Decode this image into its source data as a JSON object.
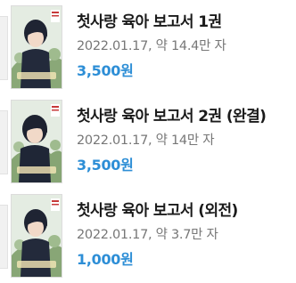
{
  "books": [
    {
      "title": "첫사랑 육아 보고서 1권",
      "date": "2022.01.17",
      "separator": ",",
      "count_label": "약 14.4만 자",
      "price": "3,500원",
      "cover_colors": {
        "bg": "#dce6dc",
        "hair": "#1d2230",
        "shirt": "#1f2636",
        "accent": "#c73a3a",
        "foliage": "#7a9a6a"
      }
    },
    {
      "title": "첫사랑 육아 보고서 2권 (완결)",
      "date": "2022.01.17",
      "separator": ",",
      "count_label": "약 14만 자",
      "price": "3,500원",
      "cover_colors": {
        "bg": "#dce6dc",
        "hair": "#1d2230",
        "shirt": "#1f2636",
        "accent": "#c73a3a",
        "foliage": "#7a9a6a"
      }
    },
    {
      "title": "첫사랑 육아 보고서 (외전)",
      "date": "2022.01.17",
      "separator": ",",
      "count_label": "약 3.7만 자",
      "price": "1,000원",
      "cover_colors": {
        "bg": "#dce6dc",
        "hair": "#1d2230",
        "shirt": "#1f2636",
        "accent": "#c73a3a",
        "foliage": "#7a9a6a"
      }
    }
  ],
  "colors": {
    "title": "#1a1a1a",
    "meta": "#777777",
    "price": "#2d8ed6"
  }
}
